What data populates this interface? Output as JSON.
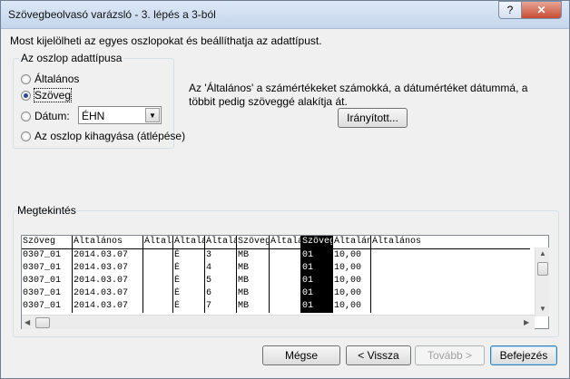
{
  "window": {
    "title": "Szövegbeolvasó varázsló - 3. lépés a 3-ból",
    "help": "?",
    "close": "✕"
  },
  "description": "Most kijelölheti az egyes oszlopokat és beállíthatja az adattípust.",
  "datatype_group": {
    "legend": "Az oszlop adattípusa",
    "options": [
      {
        "label": "Általános",
        "checked": false
      },
      {
        "label": "Szöveg",
        "checked": true
      },
      {
        "label": "Dátum:",
        "checked": false
      },
      {
        "label": "Az oszlop kihagyása (átlépése)",
        "checked": false
      }
    ],
    "date_format": "ÉHN"
  },
  "info_text": "Az 'Általános' a számértékeket számokká, a dátumértéket dátummá, a többit pedig szöveggé alakítja át.",
  "advanced_button": "Irányított...",
  "preview": {
    "label": "Megtekintés",
    "headers": [
      "Szöveg",
      "Általános",
      "Általános",
      "Általános",
      "Általános",
      "Szöveg",
      "Általános",
      "Szöveg",
      "Általános",
      "Általános"
    ],
    "rows": [
      [
        "0307_01",
        "2014.03.07",
        "",
        "É",
        "3",
        "MB",
        "",
        "01",
        "10,00",
        ""
      ],
      [
        "0307_01",
        "2014.03.07",
        "",
        "É",
        "4",
        "MB",
        "",
        "01",
        "10,00",
        ""
      ],
      [
        "0307_01",
        "2014.03.07",
        "",
        "É",
        "5",
        "MB",
        "",
        "01",
        "10,00",
        ""
      ],
      [
        "0307_01",
        "2014.03.07",
        "",
        "É",
        "6",
        "MB",
        "",
        "01",
        "10,00",
        ""
      ],
      [
        "0307_01",
        "2014.03.07",
        "",
        "É",
        "7",
        "MB",
        "",
        "01",
        "10,00",
        ""
      ]
    ],
    "selected_column": 7
  },
  "buttons": {
    "cancel": "Mégse",
    "back": "< Vissza",
    "next": "Tovább >",
    "finish": "Befejezés"
  }
}
